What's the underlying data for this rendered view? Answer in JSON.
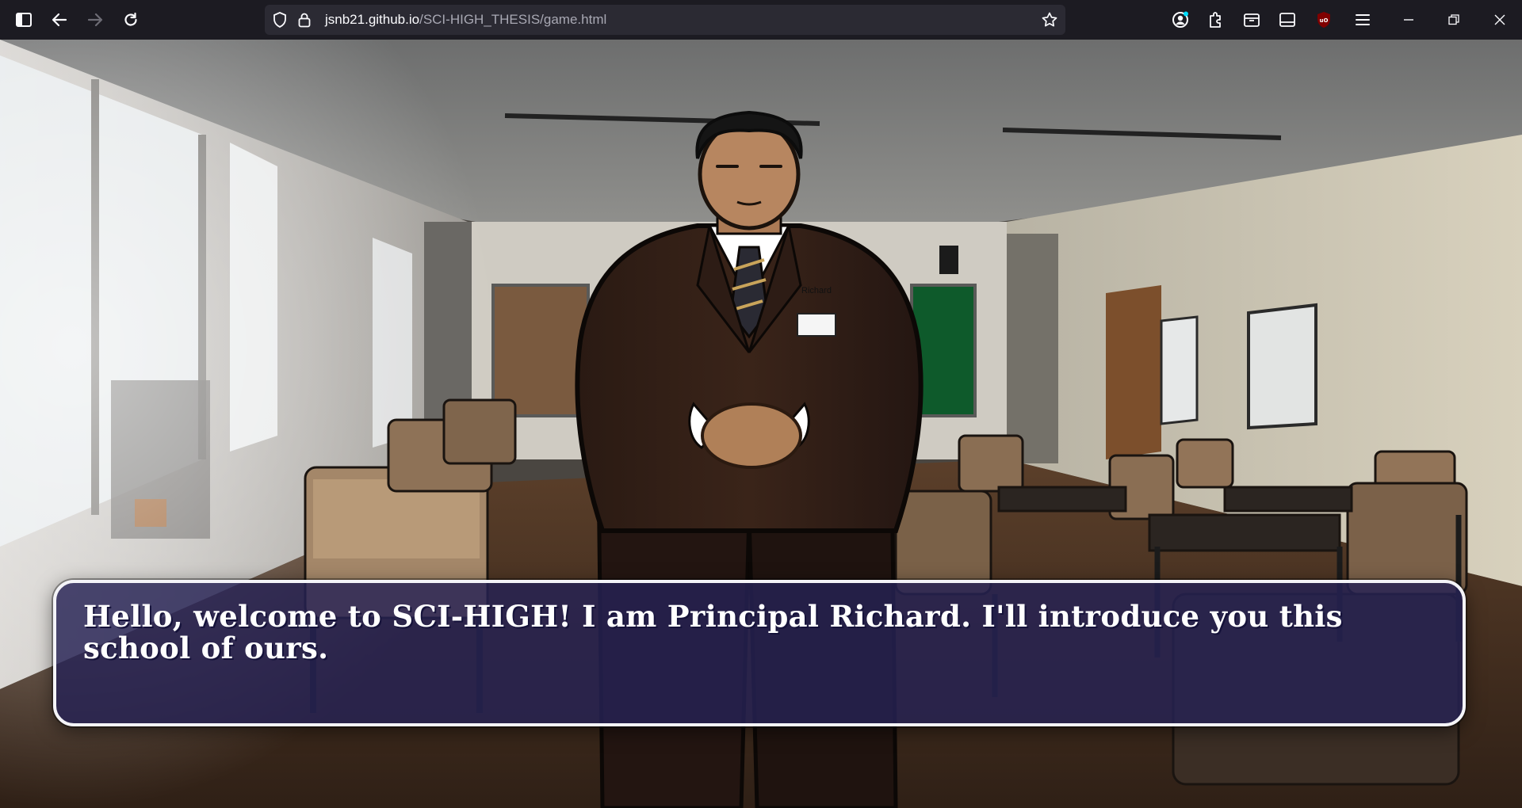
{
  "browser": {
    "url_host": "jsnb21.github.io",
    "url_path": "/SCI-HIGH_THESIS/game.html",
    "icons": [
      "sidebar-icon",
      "back-icon",
      "forward-icon",
      "reload-icon",
      "shield-icon",
      "lock-icon",
      "bookmark-star-icon",
      "account-icon",
      "extensions-icon",
      "container-icon",
      "tab-sidebar-icon",
      "ublock-icon",
      "menu-icon",
      "minimize-icon",
      "restore-icon",
      "close-icon"
    ]
  },
  "game": {
    "character_name": "Richard",
    "dialogue": "Hello, welcome to SCI-HIGH! I am Principal Richard. I'll introduce you this school of ours."
  },
  "colors": {
    "toolbar": "#1c1b22",
    "urlbar": "#2b2a33",
    "dialog_bg": "#262254",
    "dialog_border": "#f4f4f8"
  }
}
